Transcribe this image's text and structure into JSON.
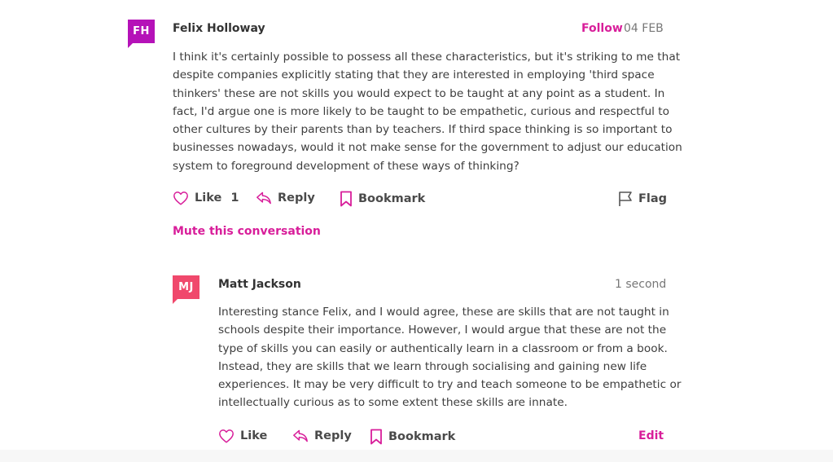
{
  "comment1": {
    "initials": "FH",
    "author": "Felix Holloway",
    "follow_label": "Follow",
    "date": "04 FEB",
    "lines": [
      "I think it's certainly possible to possess all these characteristics, but it's striking to me that",
      "despite companies explicitly stating that they are interested in employing 'third space",
      "thinkers' these are not skills you would expect to be taught at any point as a student. In",
      "fact, I'd argue one is more likely to be taught to be empathetic, curious and respectful to",
      "other cultures by their parents than by teachers. If third space thinking is so important to",
      "businesses nowadays, would it not make sense for the government to adjust our education",
      "system to foreground development of these ways of thinking?"
    ],
    "like_label": "Like",
    "like_count": "1",
    "reply_label": "Reply",
    "bookmark_label": "Bookmark",
    "flag_label": "Flag",
    "mute_label": "Mute this conversation"
  },
  "comment2": {
    "initials": "MJ",
    "author": "Matt Jackson",
    "time": "1 second",
    "lines": [
      "Interesting stance Felix, and I would agree, these are skills that are not taught in",
      "schools despite their importance. However, I would argue that these are not the",
      "type of skills you can easily or authentically learn in a classroom or from a book.",
      "Instead, they are skills that we learn through socialising and gaining new life",
      "experiences. It may be very difficult to try and teach someone to be empathetic or",
      "intellectually curious as to some extent these skills are innate."
    ],
    "like_label": "Like",
    "reply_label": "Reply",
    "bookmark_label": "Bookmark",
    "edit_label": "Edit"
  },
  "colors": {
    "accent": "#d81e9a",
    "avatar_fh": "#b512b8",
    "avatar_mj": "#f0486c"
  },
  "icons": [
    "heart-icon",
    "reply-icon",
    "bookmark-icon",
    "flag-icon"
  ]
}
